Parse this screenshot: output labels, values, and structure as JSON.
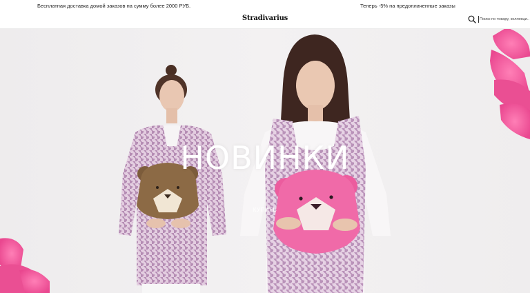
{
  "header": {
    "promo_left": "Бесплатная доставка домой заказов на сумму более 2000 РУБ.",
    "promo_right": "Теперь -5% на предоплаченные заказы",
    "logo_text": "Stradivarius",
    "search": {
      "placeholder": "Поиск по товару, коллекци...",
      "icon": "search-icon"
    }
  },
  "hero": {
    "title": "НОВИНКИ",
    "cta_label": "КУПИТЬ"
  },
  "colors": {
    "hero_background": "#f0eeef",
    "flower_pink": "#ef5fa0",
    "bag_brown": "#8c6a45",
    "bag_pink": "#f06aa8",
    "houndstooth_lilac": "#c8a6c6",
    "text_white": "#ffffff"
  }
}
